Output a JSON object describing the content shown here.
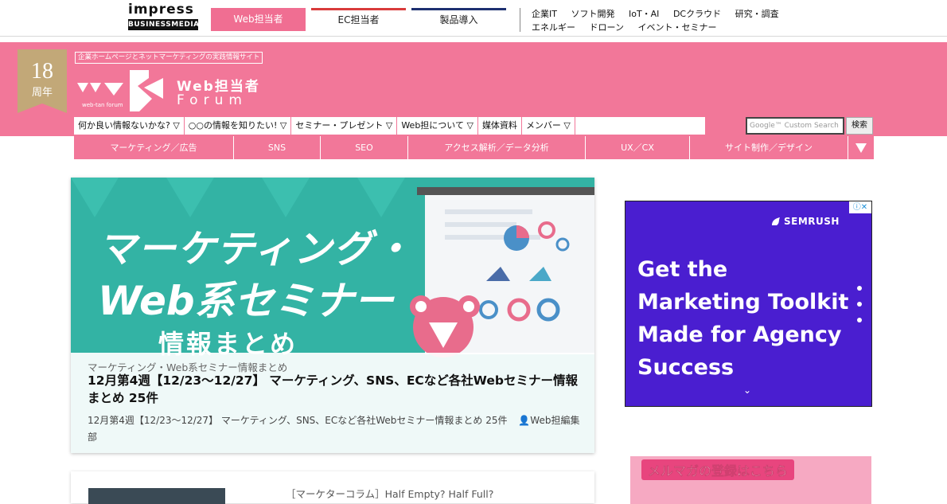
{
  "topbar": {
    "brand_word": "impress",
    "brand_sub": "BUSINESSMEDIA",
    "tabs": [
      {
        "label": "Web担当者"
      },
      {
        "label": "EC担当者"
      },
      {
        "label": "製品導入"
      }
    ],
    "links_row1": [
      "企業IT",
      "ソフト開発",
      "IoT・AI",
      "DCクラウド",
      "研究・調査"
    ],
    "links_row2": [
      "エネルギー",
      "ドローン",
      "イベント・セミナー"
    ]
  },
  "header": {
    "badge_number": "18",
    "badge_suffix": "周年",
    "tagline": "企業ホームページとネットマーケティングの実践情報サイト",
    "logo_line1": "Web担当者",
    "logo_line2": "Forum",
    "logo_small": "web-tan forum",
    "nav": [
      "何か良い情報ないかな? ▽",
      "○○の情報を知りたい! ▽",
      "セミナー・プレゼント ▽",
      "Web担について ▽",
      "媒体資料",
      "メンバー ▽"
    ],
    "search_placeholder": "Google™ Custom Search",
    "search_button": "検索",
    "categories": [
      "マーケティング／広告",
      "SNS",
      "SEO",
      "アクセス解析／データ分析",
      "UX／CX",
      "サイト制作／デザイン"
    ]
  },
  "feature": {
    "image_line1": "マーケティング・",
    "image_line2": "Web系セミナー",
    "image_line3": "情報まとめ",
    "category": "マーケティング・Web系セミナー情報まとめ",
    "title": "12月第4週【12/23〜12/27】 マーケティング、SNS、ECなど各社Webセミナー情報まとめ 25件",
    "description": "12月第4週【12/23〜12/27】 マーケティング、SNS、ECなど各社Webセミナー情報まとめ 25件",
    "author": "Web担編集部"
  },
  "card2": {
    "title": "［マーケターコラム］Half Empty? Half Full?"
  },
  "ad": {
    "brand": "SEMRUSH",
    "headline": "Get the Marketing Toolkit Made for Agency Success",
    "choice": "ⓘ✕"
  },
  "newsletter": {
    "label": "メルマガの登録はこちら"
  },
  "colors": {
    "brand_pink": "#f27799",
    "ad_purple": "#4a1ed0",
    "feature_teal": "#33b3a4"
  }
}
